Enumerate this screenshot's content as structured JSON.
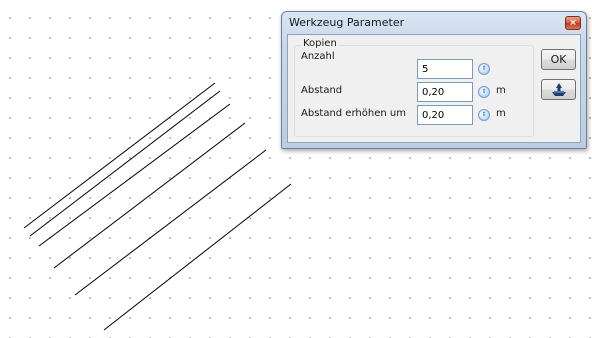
{
  "dialog": {
    "title": "Werkzeug Parameter",
    "close_label": "×",
    "group_label": "Kopien",
    "rows": [
      {
        "label": "Anzahl",
        "value": "5",
        "unit": ""
      },
      {
        "label": "Abstand",
        "value": "0,20",
        "unit": "m"
      },
      {
        "label": "Abstand erhöhen um",
        "value": "0,20",
        "unit": "m"
      }
    ],
    "ok_label": "OK",
    "spin_icon": "⇕"
  },
  "icons": {
    "dialog_close": "close-icon",
    "spinner": "spin-arrows-icon",
    "pick_tool": "pick-tool-icon"
  },
  "colors": {
    "grid_dot": "#b4b4b4",
    "title_gradient": "#c9d9ec",
    "close_button": "#d65a3b",
    "line_color": "#000000"
  }
}
